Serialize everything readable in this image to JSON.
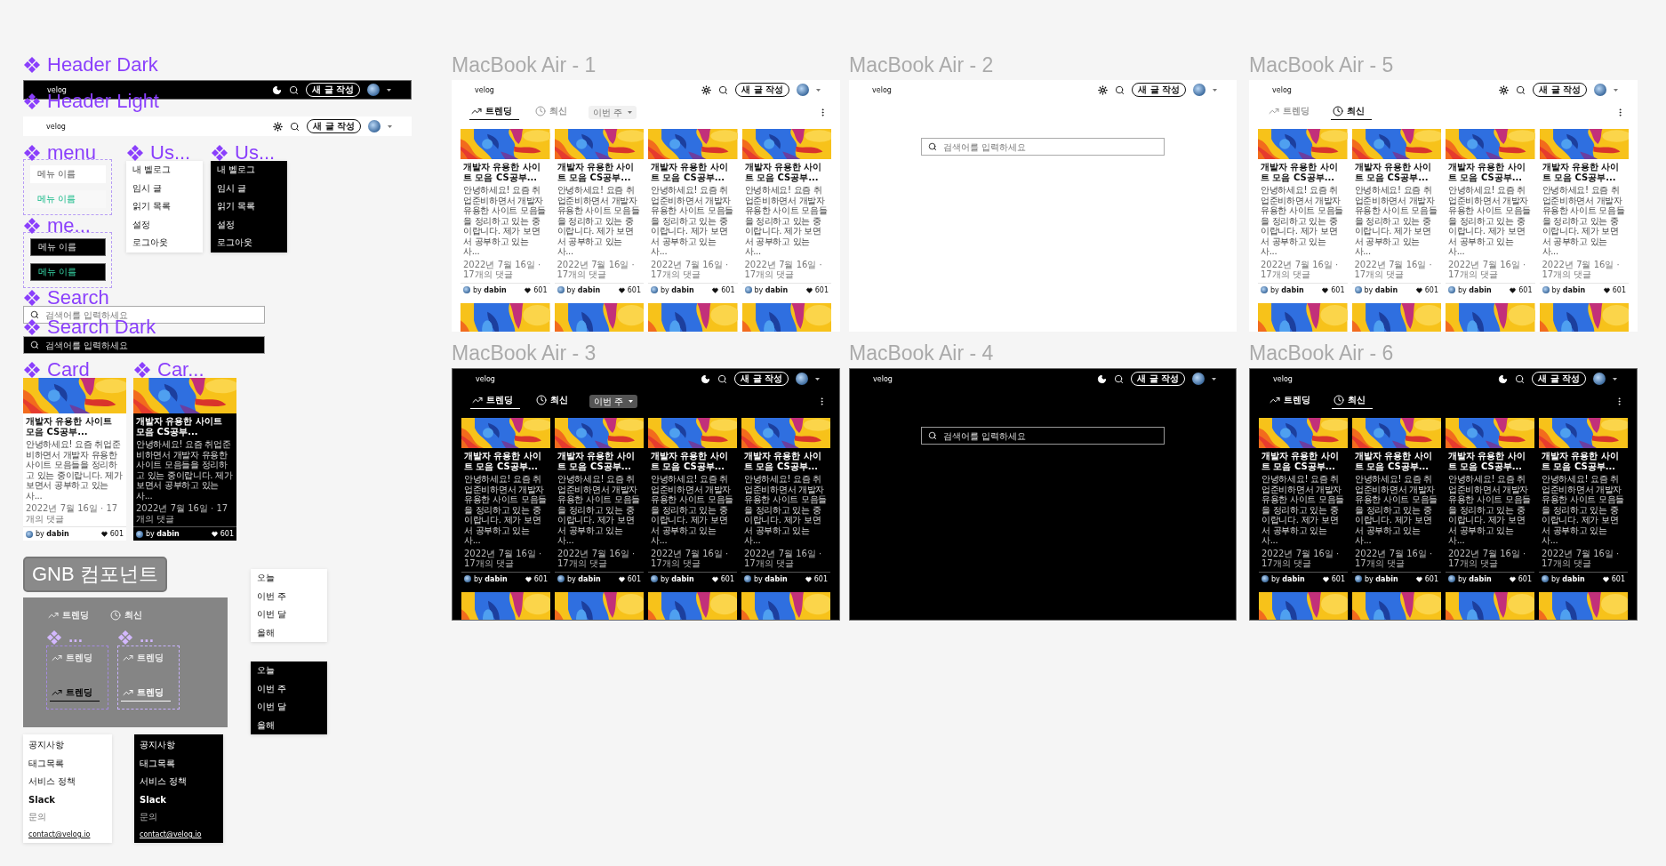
{
  "headers": [
    {
      "label": "Header Dark",
      "dark": true,
      "logo": "velog",
      "write_button": "새 글 작성"
    },
    {
      "label": "Header Light",
      "dark": false,
      "logo": "velog",
      "write_button": "새 글 작성"
    }
  ],
  "menus": [
    {
      "label": "menu",
      "dark": false,
      "items": [
        {
          "text": "메뉴 이름",
          "selected": false
        },
        {
          "text": "메뉴 이름",
          "selected": true
        }
      ]
    },
    {
      "label": "me...",
      "dark": true,
      "items": [
        {
          "text": "메뉴 이름",
          "selected": false
        },
        {
          "text": "메뉴 이름",
          "selected": true
        }
      ]
    }
  ],
  "user_menus": [
    {
      "label": "Us...",
      "dark": false,
      "items": [
        "내 벨로그",
        "임시 글",
        "읽기 목록",
        "설정",
        "로그아웃"
      ]
    },
    {
      "label": "Us...",
      "dark": true,
      "items": [
        "내 벨로그",
        "임시 글",
        "읽기 목록",
        "설정",
        "로그아웃"
      ]
    }
  ],
  "searches": [
    {
      "label": "Search",
      "dark": false,
      "placeholder": "검색어를 입력하세요"
    },
    {
      "label": "Search Dark",
      "dark": true,
      "placeholder": "검색어를 입력하세요"
    }
  ],
  "cards": [
    {
      "label": "Card",
      "dark": false,
      "card": {
        "kind": "post",
        "title": "개발자 유용한 사이트 모음 CS공부...",
        "excerpt": "안녕하세요! 요즘 취업준비하면서 개발자 유용한 사이트 모음들을 정리하고 있는 중이랍니다. 제가 보면서 공부하고 있는 사...",
        "date": "2022년 7월 16일 · 17개의 댓글",
        "author": "by **dabin**",
        "likes": "601"
      }
    },
    {
      "label": "Car...",
      "dark": true,
      "card": {
        "kind": "post",
        "title": "개발자 유용한 사이트 모음 CS공부...",
        "excerpt": "안녕하세요! 요즘 취업준비하면서 개발자 유용한 사이트 모음들을 정리하고 있는 중이랍니다. 제가 보면서 공부하고 있는 사...",
        "date": "2022년 7월 16일 · 17개의 댓글",
        "author": "by **dabin**",
        "likes": "601"
      }
    }
  ],
  "gnb": {
    "title": "GNB 컴포넌트",
    "tabs": [
      {
        "label": "트렌딩",
        "kind": "trending",
        "selected": false
      },
      {
        "label": "최신",
        "kind": "recent",
        "selected": false
      }
    ],
    "variants": [
      {
        "label": "...",
        "dark": false,
        "tabs": [
          {
            "label": "트렌딩",
            "kind": "trending",
            "selected": false
          },
          {
            "label": "트렌딩",
            "kind": "trending",
            "selected": true
          }
        ]
      },
      {
        "label": "...",
        "dark": true,
        "tabs": [
          {
            "label": "트렌딩",
            "kind": "trending",
            "selected": false
          },
          {
            "label": "트렌딩",
            "kind": "trending",
            "selected": true
          }
        ]
      }
    ]
  },
  "period_menus": [
    {
      "dark": false,
      "items": [
        "오늘",
        "이번 주",
        "이번 달",
        "올해"
      ]
    },
    {
      "dark": true,
      "items": [
        "오늘",
        "이번 주",
        "이번 달",
        "올해"
      ]
    }
  ],
  "footer_menus": [
    {
      "dark": false,
      "items": [
        {
          "text": "공지사항",
          "bold": false
        },
        {
          "text": "태그목록",
          "bold": false
        },
        {
          "text": "서비스 정책",
          "bold": false
        },
        {
          "text": "Slack",
          "bold": true
        }
      ],
      "contact_label": "문의",
      "contact_email": "contact@velog.io"
    },
    {
      "dark": true,
      "items": [
        {
          "text": "공지사항",
          "bold": false
        },
        {
          "text": "태그목록",
          "bold": false
        },
        {
          "text": "서비스 정책",
          "bold": false
        },
        {
          "text": "Slack",
          "bold": true
        }
      ],
      "contact_label": "문의",
      "contact_email": "contact@velog.io"
    }
  ],
  "frames": [
    {
      "title": "MacBook Air - 1",
      "dark": false,
      "kind": "feed",
      "logo": "velog",
      "write_button": "새 글 작성",
      "tabs": [
        {
          "label": "트렌딩",
          "kind": "trending",
          "selected": true
        },
        {
          "label": "최신",
          "kind": "recent",
          "selected": false
        }
      ],
      "period": "이번 주",
      "cards": [
        {
          "kind": "post",
          "title": "개발자 유용한 사이트 모음 CS공부...",
          "excerpt": "안녕하세요! 요즘 취업준비하면서 개발자 유용한 사이트 모음들을 정리하고 있는 중이랍니다. 제가 보면서 공부하고 있는 사...",
          "date": "2022년 7월 16일 · 17개의 댓글",
          "author": "by **dabin**",
          "likes": "601"
        },
        {
          "kind": "post",
          "title": "개발자 유용한 사이트 모음 CS공부...",
          "excerpt": "안녕하세요! 요즘 취업준비하면서 개발자 유용한 사이트 모음들을 정리하고 있는 중이랍니다. 제가 보면서 공부하고 있는 사...",
          "date": "2022년 7월 16일 · 17개의 댓글",
          "author": "by **dabin**",
          "likes": "601"
        },
        {
          "kind": "post",
          "title": "개발자 유용한 사이트 모음 CS공부...",
          "excerpt": "안녕하세요! 요즘 취업준비하면서 개발자 유용한 사이트 모음들을 정리하고 있는 중이랍니다. 제가 보면서 공부하고 있는 사...",
          "date": "2022년 7월 16일 · 17개의 댓글",
          "author": "by **dabin**",
          "likes": "601"
        },
        {
          "kind": "post",
          "title": "개발자 유용한 사이트 모음 CS공부...",
          "excerpt": "안녕하세요! 요즘 취업준비하면서 개발자 유용한 사이트 모음들을 정리하고 있는 중이랍니다. 제가 보면서 공부하고 있는 사...",
          "date": "2022년 7월 16일 · 17개의 댓글",
          "author": "by **dabin**",
          "likes": "601"
        },
        {
          "kind": "picture"
        },
        {
          "kind": "picture"
        },
        {
          "kind": "picture"
        },
        {
          "kind": "picture"
        }
      ]
    },
    {
      "title": "MacBook Air - 2",
      "dark": false,
      "kind": "search",
      "logo": "velog",
      "write_button": "새 글 작성",
      "placeholder": "검색어를 입력하세요"
    },
    {
      "title": "MacBook Air - 5",
      "dark": false,
      "kind": "feed",
      "logo": "velog",
      "write_button": "새 글 작성",
      "tabs": [
        {
          "label": "트렌딩",
          "kind": "trending",
          "selected": false
        },
        {
          "label": "최신",
          "kind": "recent",
          "selected": true
        }
      ],
      "cards": [
        {
          "kind": "post",
          "title": "개발자 유용한 사이트 모음 CS공부...",
          "excerpt": "안녕하세요! 요즘 취업준비하면서 개발자 유용한 사이트 모음들을 정리하고 있는 중이랍니다. 제가 보면서 공부하고 있는 사...",
          "date": "2022년 7월 16일 · 17개의 댓글",
          "author": "by **dabin**",
          "likes": "601"
        },
        {
          "kind": "post",
          "title": "개발자 유용한 사이트 모음 CS공부...",
          "excerpt": "안녕하세요! 요즘 취업준비하면서 개발자 유용한 사이트 모음들을 정리하고 있는 중이랍니다. 제가 보면서 공부하고 있는 사...",
          "date": "2022년 7월 16일 · 17개의 댓글",
          "author": "by **dabin**",
          "likes": "601"
        },
        {
          "kind": "post",
          "title": "개발자 유용한 사이트 모음 CS공부...",
          "excerpt": "안녕하세요! 요즘 취업준비하면서 개발자 유용한 사이트 모음들을 정리하고 있는 중이랍니다. 제가 보면서 공부하고 있는 사...",
          "date": "2022년 7월 16일 · 17개의 댓글",
          "author": "by **dabin**",
          "likes": "601"
        },
        {
          "kind": "post",
          "title": "개발자 유용한 사이트 모음 CS공부...",
          "excerpt": "안녕하세요! 요즘 취업준비하면서 개발자 유용한 사이트 모음들을 정리하고 있는 중이랍니다. 제가 보면서 공부하고 있는 사...",
          "date": "2022년 7월 16일 · 17개의 댓글",
          "author": "by **dabin**",
          "likes": "601"
        },
        {
          "kind": "picture"
        },
        {
          "kind": "picture"
        },
        {
          "kind": "picture"
        },
        {
          "kind": "picture"
        }
      ]
    },
    {
      "title": "MacBook Air - 3",
      "dark": true,
      "kind": "feed",
      "logo": "velog",
      "write_button": "새 글 작성",
      "tabs": [
        {
          "label": "트렌딩",
          "kind": "trending",
          "selected": true
        },
        {
          "label": "최신",
          "kind": "recent",
          "selected": false
        }
      ],
      "period": "이번 주",
      "cards": [
        {
          "kind": "post",
          "title": "개발자 유용한 사이트 모음 CS공부...",
          "excerpt": "안녕하세요! 요즘 취업준비하면서 개발자 유용한 사이트 모음들을 정리하고 있는 중이랍니다. 제가 보면서 공부하고 있는 사...",
          "date": "2022년 7월 16일 · 17개의 댓글",
          "author": "by **dabin**",
          "likes": "601"
        },
        {
          "kind": "post",
          "title": "개발자 유용한 사이트 모음 CS공부...",
          "excerpt": "안녕하세요! 요즘 취업준비하면서 개발자 유용한 사이트 모음들을 정리하고 있는 중이랍니다. 제가 보면서 공부하고 있는 사...",
          "date": "2022년 7월 16일 · 17개의 댓글",
          "author": "by **dabin**",
          "likes": "601"
        },
        {
          "kind": "post",
          "title": "개발자 유용한 사이트 모음 CS공부...",
          "excerpt": "안녕하세요! 요즘 취업준비하면서 개발자 유용한 사이트 모음들을 정리하고 있는 중이랍니다. 제가 보면서 공부하고 있는 사...",
          "date": "2022년 7월 16일 · 17개의 댓글",
          "author": "by **dabin**",
          "likes": "601"
        },
        {
          "kind": "post",
          "title": "개발자 유용한 사이트 모음 CS공부...",
          "excerpt": "안녕하세요! 요즘 취업준비하면서 개발자 유용한 사이트 모음들을 정리하고 있는 중이랍니다. 제가 보면서 공부하고 있는 사...",
          "date": "2022년 7월 16일 · 17개의 댓글",
          "author": "by **dabin**",
          "likes": "601"
        },
        {
          "kind": "picture"
        },
        {
          "kind": "picture"
        },
        {
          "kind": "picture"
        },
        {
          "kind": "picture"
        }
      ]
    },
    {
      "title": "MacBook Air - 4",
      "dark": true,
      "kind": "search",
      "logo": "velog",
      "write_button": "새 글 작성",
      "placeholder": "검색어를 입력하세요"
    },
    {
      "title": "MacBook Air - 6",
      "dark": true,
      "kind": "feed",
      "logo": "velog",
      "write_button": "새 글 작성",
      "tabs": [
        {
          "label": "트렌딩",
          "kind": "trending",
          "selected": false
        },
        {
          "label": "최신",
          "kind": "recent",
          "selected": true
        }
      ],
      "cards": [
        {
          "kind": "post",
          "title": "개발자 유용한 사이트 모음 CS공부...",
          "excerpt": "안녕하세요! 요즘 취업준비하면서 개발자 유용한 사이트 모음들을 정리하고 있는 중이랍니다. 제가 보면서 공부하고 있는 사...",
          "date": "2022년 7월 16일 · 17개의 댓글",
          "author": "by **dabin**",
          "likes": "601"
        },
        {
          "kind": "post",
          "title": "개발자 유용한 사이트 모음 CS공부...",
          "excerpt": "안녕하세요! 요즘 취업준비하면서 개발자 유용한 사이트 모음들을 정리하고 있는 중이랍니다. 제가 보면서 공부하고 있는 사...",
          "date": "2022년 7월 16일 · 17개의 댓글",
          "author": "by **dabin**",
          "likes": "601"
        },
        {
          "kind": "post",
          "title": "개발자 유용한 사이트 모음 CS공부...",
          "excerpt": "안녕하세요! 요즘 취업준비하면서 개발자 유용한 사이트 모음들을 정리하고 있는 중이랍니다. 제가 보면서 공부하고 있는 사...",
          "date": "2022년 7월 16일 · 17개의 댓글",
          "author": "by **dabin**",
          "likes": "601"
        },
        {
          "kind": "post",
          "title": "개발자 유용한 사이트 모음 CS공부...",
          "excerpt": "안녕하세요! 요즘 취업준비하면서 개발자 유용한 사이트 모음들을 정리하고 있는 중이랍니다. 제가 보면서 공부하고 있는 사...",
          "date": "2022년 7월 16일 · 17개의 댓글",
          "author": "by **dabin**",
          "likes": "601"
        },
        {
          "kind": "picture"
        },
        {
          "kind": "picture"
        },
        {
          "kind": "picture"
        },
        {
          "kind": "picture"
        }
      ]
    }
  ]
}
